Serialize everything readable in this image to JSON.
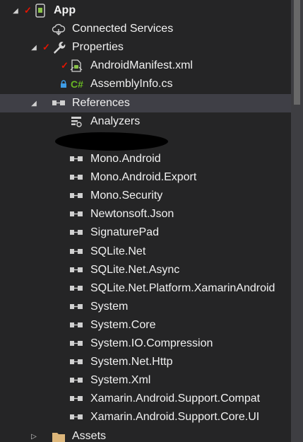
{
  "tree": {
    "project": {
      "label": "App"
    },
    "connected_services": {
      "label": "Connected Services"
    },
    "properties": {
      "label": "Properties",
      "items": [
        "AndroidManifest.xml",
        "AssemblyInfo.cs"
      ]
    },
    "references": {
      "label": "References",
      "analyzers": "Analyzers",
      "items": [
        "Mono.Android",
        "Mono.Android.Export",
        "Mono.Security",
        "Newtonsoft.Json",
        "SignaturePad",
        "SQLite.Net",
        "SQLite.Net.Async",
        "SQLite.Net.Platform.XamarinAndroid",
        "System",
        "System.Core",
        "System.IO.Compression",
        "System.Net.Http",
        "System.Xml",
        "Xamarin.Android.Support.Compat",
        "Xamarin.Android.Support.Core.UI"
      ]
    },
    "assets": {
      "label": "Assets"
    }
  },
  "colors": {
    "background": "#252526",
    "selected_row": "#3f3f46",
    "check_red": "#e51400",
    "csharp_green": "#68b723",
    "lock_blue": "#3e9ce6",
    "folder_orange": "#dcb67a"
  },
  "icons": {
    "project": "android-phone-icon",
    "connected_services": "cloud-icon",
    "properties": "wrench-icon",
    "manifest": "android-manifest-icon",
    "assemblyinfo": "csharp-file-icon",
    "references": "reference-icon",
    "analyzers": "analyzer-icon",
    "assets": "folder-icon"
  }
}
